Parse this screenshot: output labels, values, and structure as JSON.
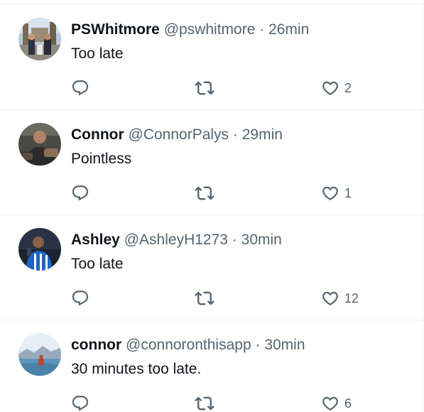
{
  "colors": {
    "text_primary": "#0f1419",
    "text_secondary": "#536471",
    "divider": "#eff3f4"
  },
  "tweets": [
    {
      "name": "PSWhitmore",
      "handle": "@pswhitmore",
      "separator": "·",
      "time": "26min",
      "text": "Too late",
      "like_count": "2",
      "icons": [
        "reply-icon",
        "retweet-icon",
        "like-icon"
      ]
    },
    {
      "name": "Connor",
      "handle": "@ConnorPalys",
      "separator": "·",
      "time": "29min",
      "text": "Pointless",
      "like_count": "1",
      "icons": [
        "reply-icon",
        "retweet-icon",
        "like-icon"
      ]
    },
    {
      "name": "Ashley",
      "handle": "@AshleyH1273",
      "separator": "·",
      "time": "30min",
      "text": "Too late",
      "like_count": "12",
      "icons": [
        "reply-icon",
        "retweet-icon",
        "like-icon"
      ]
    },
    {
      "name": "connor",
      "handle": "@connoronthisapp",
      "separator": "·",
      "time": "30min",
      "text": "30 minutes too late.",
      "like_count": "6",
      "icons": [
        "reply-icon",
        "retweet-icon",
        "like-icon"
      ]
    }
  ]
}
